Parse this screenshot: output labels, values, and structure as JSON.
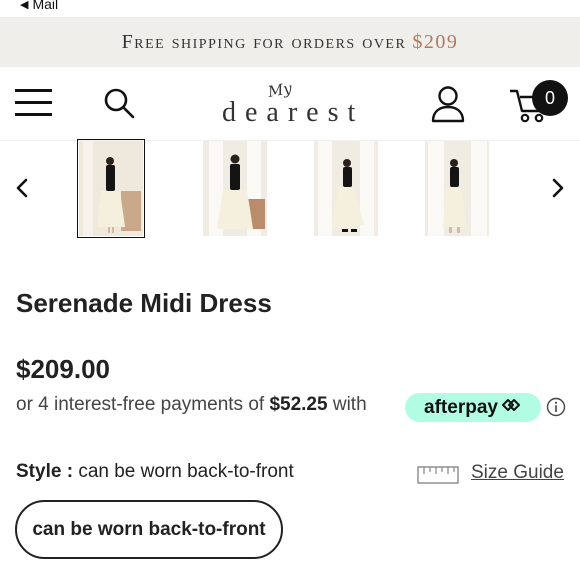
{
  "status_bar": {
    "back_label": "Mail"
  },
  "promo": {
    "text": "Free shipping for orders over",
    "amount": "$209"
  },
  "header": {
    "logo_script": "My",
    "logo_word": "dearest",
    "cart_count": "0"
  },
  "carousel": {
    "thumbnails": [
      {
        "alt": "product-image-1",
        "selected": true
      },
      {
        "alt": "product-image-2",
        "selected": false
      },
      {
        "alt": "product-image-3",
        "selected": false
      },
      {
        "alt": "product-image-4",
        "selected": false
      }
    ]
  },
  "product": {
    "title": "Serenade Midi Dress",
    "price": "$209.00",
    "installment_prefix": "or 4 interest-free payments of",
    "installment_amount": "$52.25",
    "installment_suffix": "with",
    "afterpay_label": "afterpay"
  },
  "style": {
    "label": "Style :",
    "value": "can be worn back-to-front",
    "size_guide": "Size Guide",
    "option": "can be worn back-to-front"
  },
  "colors": {
    "promo_bg": "#efeeea",
    "promo_amount": "#b07a5e",
    "afterpay_mint": "#b2fce4"
  }
}
